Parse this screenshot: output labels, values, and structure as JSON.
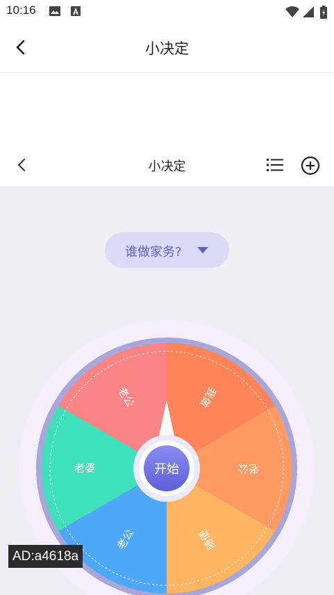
{
  "status_bar": {
    "time": "10:16"
  },
  "top_bar": {
    "title": "小决定"
  },
  "sub_bar": {
    "title": "小决定"
  },
  "question": {
    "label": "谁做家务?"
  },
  "wheel": {
    "start_label": "开始",
    "segments": [
      {
        "label": "我做",
        "color": "#ff8458"
      },
      {
        "label": "老公",
        "color": "#ff9a62"
      },
      {
        "label": "随便",
        "color": "#ffb562"
      },
      {
        "label": "老公",
        "color": "#4fa8f7"
      },
      {
        "label": "老婆",
        "color": "#3ee1bb"
      },
      {
        "label": "老公",
        "color": "#f98585"
      }
    ]
  },
  "ad_badge": "AD:a4618a",
  "colors": {
    "accent": "#5d63c4",
    "pill_bg": "#d9dbf7",
    "content_bg": "#f0eff5"
  }
}
